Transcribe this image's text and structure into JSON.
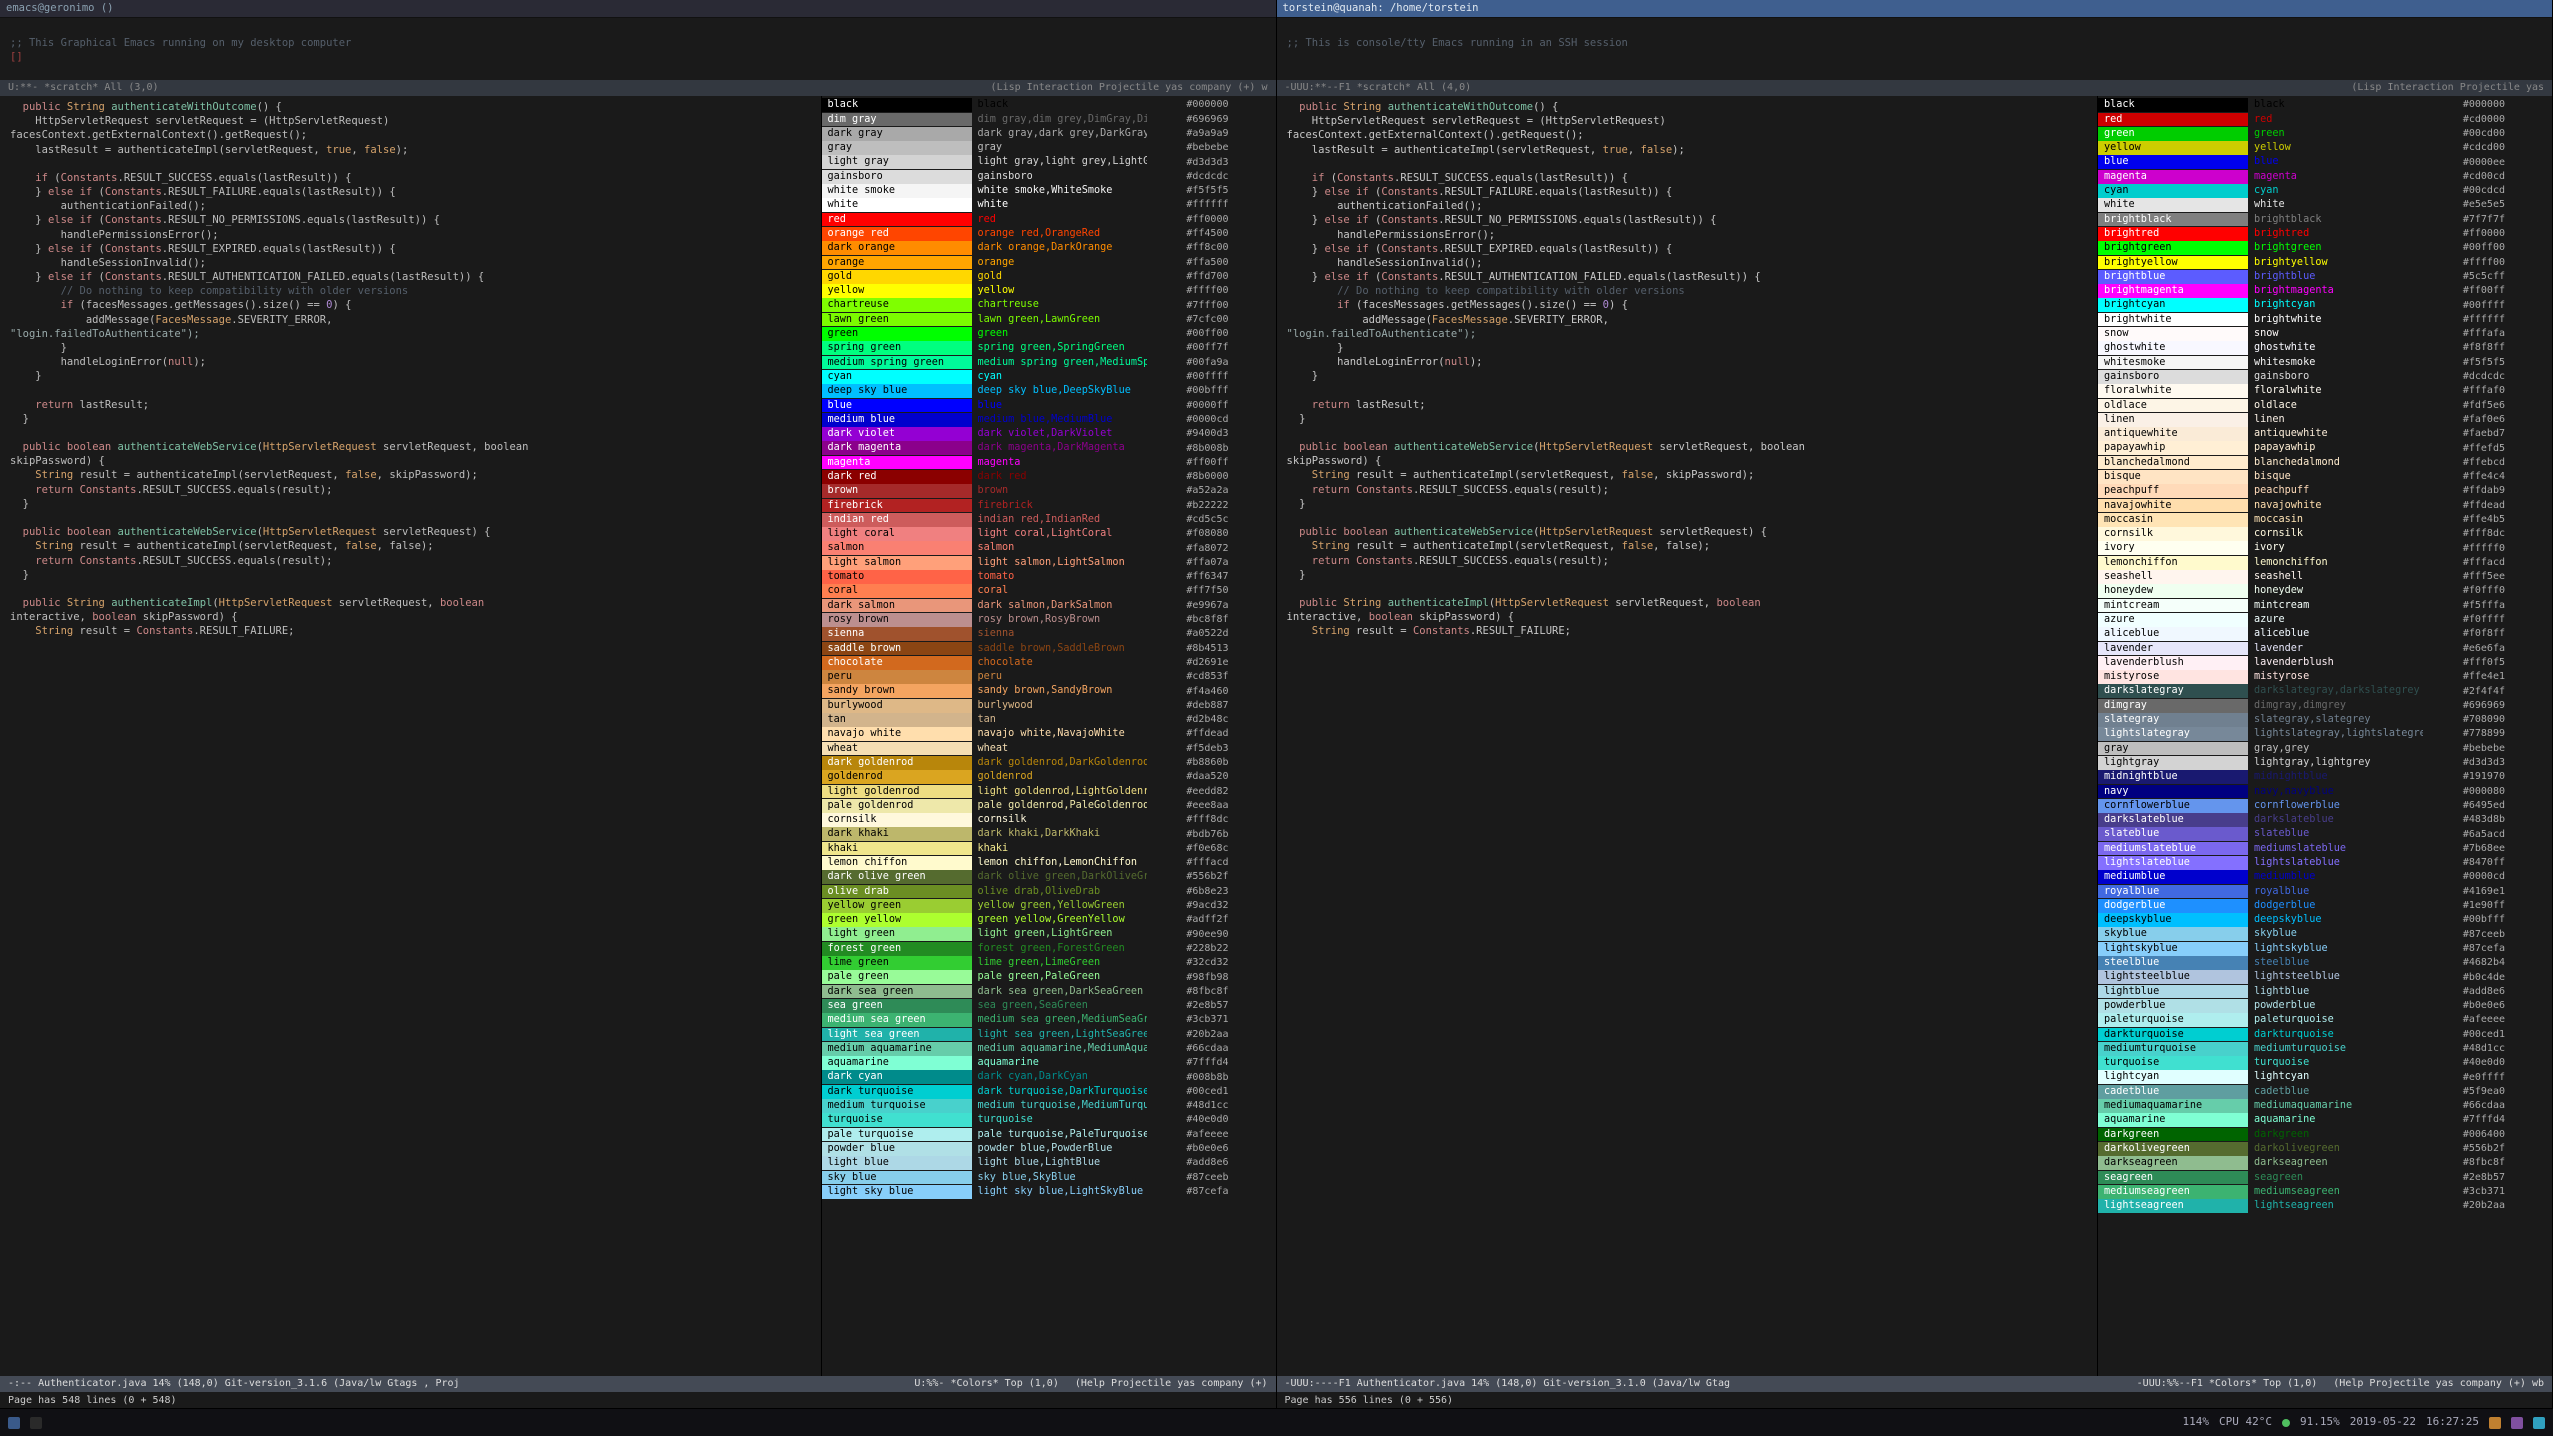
{
  "left": {
    "title": "emacs@geronimo ()",
    "scratch_comment": ";; This Graphical Emacs running on my desktop computer",
    "scratch_modeline": {
      "left": "U:**-  *scratch*   All (3,0)",
      "right": "(Lisp Interaction Projectile yas company (+) w"
    },
    "code_modeline": {
      "left": "-:--  Authenticator.java  14% (148,0)  Git-version_3.1.6  (Java/lw Gtags , Proj",
      "right": ""
    },
    "color_modeline": {
      "left": "U:%%-  *Colors*      Top (1,0)",
      "right": "(Help Projectile yas company (+)"
    },
    "minibuf": "Page has 548 lines (0 + 548)"
  },
  "right": {
    "title": "torstein@quanah: /home/torstein",
    "scratch_comment": ";; This is console/tty Emacs running in an SSH session",
    "scratch_modeline": {
      "left": "-UUU:**--F1  *scratch*      All (4,0)",
      "right": "(Lisp Interaction Projectile yas"
    },
    "code_modeline": {
      "left": "-UUU:----F1  Authenticator.java   14% (148,0)  Git-version_3.1.0  (Java/lw Gtag",
      "right": ""
    },
    "color_modeline": {
      "left": "-UUU:%%--F1  *Colors*      Top (1,0)",
      "right": "(Help Projectile yas company (+) wb"
    },
    "minibuf": "Page has 556 lines (0 + 556)"
  },
  "colors_left": [
    [
      "black",
      "#000000"
    ],
    [
      "dim gray",
      "#696969"
    ],
    [
      "dark gray",
      "#a9a9a9"
    ],
    [
      "gray",
      "#bebebe"
    ],
    [
      "light gray",
      "#d3d3d3"
    ],
    [
      "gainsboro",
      "#dcdcdc"
    ],
    [
      "white smoke",
      "#f5f5f5"
    ],
    [
      "white",
      "#ffffff"
    ],
    [
      "red",
      "#ff0000"
    ],
    [
      "orange red",
      "#ff4500"
    ],
    [
      "dark orange",
      "#ff8c00"
    ],
    [
      "orange",
      "#ffa500"
    ],
    [
      "gold",
      "#ffd700"
    ],
    [
      "yellow",
      "#ffff00"
    ],
    [
      "chartreuse",
      "#7fff00"
    ],
    [
      "lawn green",
      "#7cfc00"
    ],
    [
      "green",
      "#00ff00"
    ],
    [
      "spring green",
      "#00ff7f"
    ],
    [
      "medium spring green",
      "#00fa9a"
    ],
    [
      "cyan",
      "#00ffff"
    ],
    [
      "deep sky blue",
      "#00bfff"
    ],
    [
      "blue",
      "#0000ff"
    ],
    [
      "medium blue",
      "#0000cd"
    ],
    [
      "dark violet",
      "#9400d3"
    ],
    [
      "dark magenta",
      "#8b008b"
    ],
    [
      "magenta",
      "#ff00ff"
    ],
    [
      "dark red",
      "#8b0000"
    ],
    [
      "brown",
      "#a52a2a"
    ],
    [
      "firebrick",
      "#b22222"
    ],
    [
      "indian red",
      "#cd5c5c"
    ],
    [
      "light coral",
      "#f08080"
    ],
    [
      "salmon",
      "#fa8072"
    ],
    [
      "light salmon",
      "#ffa07a"
    ],
    [
      "tomato",
      "#ff6347"
    ],
    [
      "coral",
      "#ff7f50"
    ],
    [
      "dark salmon",
      "#e9967a"
    ],
    [
      "rosy brown",
      "#bc8f8f"
    ],
    [
      "sienna",
      "#a0522d"
    ],
    [
      "saddle brown",
      "#8b4513"
    ],
    [
      "chocolate",
      "#d2691e"
    ],
    [
      "peru",
      "#cd853f"
    ],
    [
      "sandy brown",
      "#f4a460"
    ],
    [
      "burlywood",
      "#deb887"
    ],
    [
      "tan",
      "#d2b48c"
    ],
    [
      "navajo white",
      "#ffdead"
    ],
    [
      "wheat",
      "#f5deb3"
    ],
    [
      "dark goldenrod",
      "#b8860b"
    ],
    [
      "goldenrod",
      "#daa520"
    ],
    [
      "light goldenrod",
      "#eedd82"
    ],
    [
      "pale goldenrod",
      "#eee8aa"
    ],
    [
      "cornsilk",
      "#fff8dc"
    ],
    [
      "dark khaki",
      "#bdb76b"
    ],
    [
      "khaki",
      "#f0e68c"
    ],
    [
      "lemon chiffon",
      "#fffacd"
    ],
    [
      "dark olive green",
      "#556b2f"
    ],
    [
      "olive drab",
      "#6b8e23"
    ],
    [
      "yellow green",
      "#9acd32"
    ],
    [
      "green yellow",
      "#adff2f"
    ],
    [
      "light green",
      "#90ee90"
    ],
    [
      "forest green",
      "#228b22"
    ],
    [
      "lime green",
      "#32cd32"
    ],
    [
      "pale green",
      "#98fb98"
    ],
    [
      "dark sea green",
      "#8fbc8f"
    ],
    [
      "sea green",
      "#2e8b57"
    ],
    [
      "medium sea green",
      "#3cb371"
    ],
    [
      "light sea green",
      "#20b2aa"
    ],
    [
      "medium aquamarine",
      "#66cdaa"
    ],
    [
      "aquamarine",
      "#7fffd4"
    ],
    [
      "dark cyan",
      "#008b8b"
    ],
    [
      "dark turquoise",
      "#00ced1"
    ],
    [
      "medium turquoise",
      "#48d1cc"
    ],
    [
      "turquoise",
      "#40e0d0"
    ],
    [
      "pale turquoise",
      "#afeeee"
    ],
    [
      "powder blue",
      "#b0e0e6"
    ],
    [
      "light blue",
      "#add8e6"
    ],
    [
      "sky blue",
      "#87ceeb"
    ],
    [
      "light sky blue",
      "#87cefa"
    ]
  ],
  "colors_right": [
    [
      "black",
      "#000000"
    ],
    [
      "red",
      "#cd0000"
    ],
    [
      "green",
      "#00cd00"
    ],
    [
      "yellow",
      "#cdcd00"
    ],
    [
      "blue",
      "#0000ee"
    ],
    [
      "magenta",
      "#cd00cd"
    ],
    [
      "cyan",
      "#00cdcd"
    ],
    [
      "white",
      "#e5e5e5"
    ],
    [
      "brightblack",
      "#7f7f7f"
    ],
    [
      "brightred",
      "#ff0000"
    ],
    [
      "brightgreen",
      "#00ff00"
    ],
    [
      "brightyellow",
      "#ffff00"
    ],
    [
      "brightblue",
      "#5c5cff"
    ],
    [
      "brightmagenta",
      "#ff00ff"
    ],
    [
      "brightcyan",
      "#00ffff"
    ],
    [
      "brightwhite",
      "#ffffff"
    ],
    [
      "snow",
      "#fffafa"
    ],
    [
      "ghostwhite",
      "#f8f8ff"
    ],
    [
      "whitesmoke",
      "#f5f5f5"
    ],
    [
      "gainsboro",
      "#dcdcdc"
    ],
    [
      "floralwhite",
      "#fffaf0"
    ],
    [
      "oldlace",
      "#fdf5e6"
    ],
    [
      "linen",
      "#faf0e6"
    ],
    [
      "antiquewhite",
      "#faebd7"
    ],
    [
      "papayawhip",
      "#ffefd5"
    ],
    [
      "blanchedalmond",
      "#ffebcd"
    ],
    [
      "bisque",
      "#ffe4c4"
    ],
    [
      "peachpuff",
      "#ffdab9"
    ],
    [
      "navajowhite",
      "#ffdead"
    ],
    [
      "moccasin",
      "#ffe4b5"
    ],
    [
      "cornsilk",
      "#fff8dc"
    ],
    [
      "ivory",
      "#fffff0"
    ],
    [
      "lemonchiffon",
      "#fffacd"
    ],
    [
      "seashell",
      "#fff5ee"
    ],
    [
      "honeydew",
      "#f0fff0"
    ],
    [
      "mintcream",
      "#f5fffa"
    ],
    [
      "azure",
      "#f0ffff"
    ],
    [
      "aliceblue",
      "#f0f8ff"
    ],
    [
      "lavender",
      "#e6e6fa"
    ],
    [
      "lavenderblush",
      "#fff0f5"
    ],
    [
      "mistyrose",
      "#ffe4e1"
    ],
    [
      "darkslategray",
      "#2f4f4f"
    ],
    [
      "dimgray",
      "#696969"
    ],
    [
      "slategray",
      "#708090"
    ],
    [
      "lightslategray",
      "#778899"
    ],
    [
      "gray",
      "#bebebe"
    ],
    [
      "lightgray",
      "#d3d3d3"
    ],
    [
      "midnightblue",
      "#191970"
    ],
    [
      "navy",
      "#000080"
    ],
    [
      "cornflowerblue",
      "#6495ed"
    ],
    [
      "darkslateblue",
      "#483d8b"
    ],
    [
      "slateblue",
      "#6a5acd"
    ],
    [
      "mediumslateblue",
      "#7b68ee"
    ],
    [
      "lightslateblue",
      "#8470ff"
    ],
    [
      "mediumblue",
      "#0000cd"
    ],
    [
      "royalblue",
      "#4169e1"
    ],
    [
      "dodgerblue",
      "#1e90ff"
    ],
    [
      "deepskyblue",
      "#00bfff"
    ],
    [
      "skyblue",
      "#87ceeb"
    ],
    [
      "lightskyblue",
      "#87cefa"
    ],
    [
      "steelblue",
      "#4682b4"
    ],
    [
      "lightsteelblue",
      "#b0c4de"
    ],
    [
      "lightblue",
      "#add8e6"
    ],
    [
      "powderblue",
      "#b0e0e6"
    ],
    [
      "paleturquoise",
      "#afeeee"
    ],
    [
      "darkturquoise",
      "#00ced1"
    ],
    [
      "mediumturquoise",
      "#48d1cc"
    ],
    [
      "turquoise",
      "#40e0d0"
    ],
    [
      "lightcyan",
      "#e0ffff"
    ],
    [
      "cadetblue",
      "#5f9ea0"
    ],
    [
      "mediumaquamarine",
      "#66cdaa"
    ],
    [
      "aquamarine",
      "#7fffd4"
    ],
    [
      "darkgreen",
      "#006400"
    ],
    [
      "darkolivegreen",
      "#556b2f"
    ],
    [
      "darkseagreen",
      "#8fbc8f"
    ],
    [
      "seagreen",
      "#2e8b57"
    ],
    [
      "mediumseagreen",
      "#3cb371"
    ],
    [
      "lightseagreen",
      "#20b2aa"
    ]
  ],
  "aliases_left": {
    "dim gray": "dim gray,dim grey,DimGray,DimGrey",
    "dark gray": "dark gray,dark grey,DarkGray,DarkGrey",
    "light gray": "light gray,light grey,LightGray,LightGrey",
    "white smoke": "white smoke,WhiteSmoke",
    "orange red": "orange red,OrangeRed",
    "dark orange": "dark orange,DarkOrange",
    "lawn green": "lawn green,LawnGreen",
    "spring green": "spring green,SpringGreen",
    "medium spring green": "medium spring green,MediumSpringGreen",
    "deep sky blue": "deep sky blue,DeepSkyBlue",
    "medium blue": "medium blue,MediumBlue",
    "dark violet": "dark violet,DarkViolet",
    "dark magenta": "dark magenta,DarkMagenta",
    "dark red": "dark red",
    "indian red": "indian red,IndianRed",
    "light coral": "light coral,LightCoral",
    "light salmon": "light salmon,LightSalmon",
    "dark salmon": "dark salmon,DarkSalmon",
    "rosy brown": "rosy brown,RosyBrown",
    "saddle brown": "saddle brown,SaddleBrown",
    "sandy brown": "sandy brown,SandyBrown",
    "navajo white": "navajo white,NavajoWhite",
    "dark goldenrod": "dark goldenrod,DarkGoldenrod",
    "light goldenrod": "light goldenrod,LightGoldenrod",
    "pale goldenrod": "pale goldenrod,PaleGoldenrod",
    "dark khaki": "dark khaki,DarkKhaki",
    "lemon chiffon": "lemon chiffon,LemonChiffon",
    "dark olive green": "dark olive green,DarkOliveGreen",
    "olive drab": "olive drab,OliveDrab",
    "yellow green": "yellow green,YellowGreen",
    "green yellow": "green yellow,GreenYellow",
    "light green": "light green,LightGreen",
    "forest green": "forest green,ForestGreen",
    "lime green": "lime green,LimeGreen",
    "pale green": "pale green,PaleGreen",
    "dark sea green": "dark sea green,DarkSeaGreen",
    "sea green": "sea green,SeaGreen",
    "medium sea green": "medium sea green,MediumSeaGreen",
    "light sea green": "light sea green,LightSeaGreen",
    "medium aquamarine": "medium aquamarine,MediumAquamarine",
    "dark cyan": "dark cyan,DarkCyan",
    "dark turquoise": "dark turquoise,DarkTurquoise",
    "medium turquoise": "medium turquoise,MediumTurquoise",
    "pale turquoise": "pale turquoise,PaleTurquoise",
    "powder blue": "powder blue,PowderBlue",
    "light blue": "light blue,LightBlue",
    "sky blue": "sky blue,SkyBlue",
    "light sky blue": "light sky blue,LightSkyBlue"
  },
  "aliases_right": {
    "darkslategray": "darkslategray,darkslategrey",
    "dimgray": "dimgray,dimgrey",
    "slategray": "slategray,slategrey",
    "lightslategray": "lightslategray,lightslategrey",
    "gray": "gray,grey",
    "lightgray": "lightgray,lightgrey",
    "navy": "navy,navyblue"
  },
  "code_lines": [
    {
      "t": "  public String authenticateWithOutcome() {",
      "c": [
        "kw:public",
        "type:String",
        "fn:authenticateWithOutcome"
      ]
    },
    {
      "t": "    HttpServletRequest servletRequest = (HttpServletRequest)"
    },
    {
      "t": "facesContext.getExternalContext().getRequest();"
    },
    {
      "t": "    lastResult = authenticateImpl(servletRequest, true, false);",
      "c": [
        "bool:true",
        "bool:false"
      ]
    },
    {
      "t": ""
    },
    {
      "t": "    if (Constants.RESULT_SUCCESS.equals(lastResult)) {",
      "c": [
        "kw:if",
        "const:Constants"
      ]
    },
    {
      "t": "    } else if (Constants.RESULT_FAILURE.equals(lastResult)) {",
      "c": [
        "kw:else",
        "kw:if",
        "const:Constants"
      ]
    },
    {
      "t": "        authenticationFailed();"
    },
    {
      "t": "    } else if (Constants.RESULT_NO_PERMISSIONS.equals(lastResult)) {",
      "c": [
        "kw:else",
        "kw:if",
        "const:Constants"
      ]
    },
    {
      "t": "        handlePermissionsError();"
    },
    {
      "t": "    } else if (Constants.RESULT_EXPIRED.equals(lastResult)) {",
      "c": [
        "kw:else",
        "kw:if",
        "const:Constants"
      ]
    },
    {
      "t": "        handleSessionInvalid();"
    },
    {
      "t": "    } else if (Constants.RESULT_AUTHENTICATION_FAILED.equals(lastResult)) {",
      "c": [
        "kw:else",
        "kw:if",
        "const:Constants"
      ]
    },
    {
      "t": "        // Do nothing to keep compatibility with older versions",
      "c": [
        "comment:*"
      ]
    },
    {
      "t": "        if (facesMessages.getMessages().size() == 0) {",
      "c": [
        "kw:if",
        "num:0"
      ]
    },
    {
      "t": "            addMessage(FacesMessage.SEVERITY_ERROR,",
      "c": [
        "type:FacesMessage"
      ]
    },
    {
      "t": "\"login.failedToAuthenticate\");",
      "c": [
        "str:*"
      ]
    },
    {
      "t": "        }"
    },
    {
      "t": "        handleLoginError(null);",
      "c": [
        "kw:null"
      ]
    },
    {
      "t": "    }"
    },
    {
      "t": ""
    },
    {
      "t": "    return lastResult;",
      "c": [
        "kw:return"
      ]
    },
    {
      "t": "  }"
    },
    {
      "t": ""
    },
    {
      "t": "  public boolean authenticateWebService(HttpServletRequest servletRequest, boolean",
      "c": [
        "kw:public",
        "kw:boolean",
        "fn:authenticateWebService",
        "type:HttpServletRequest",
        "kw:boolean"
      ]
    },
    {
      "t": "skipPassword) {"
    },
    {
      "t": "    String result = authenticateImpl(servletRequest, false, skipPassword);",
      "c": [
        "type:String",
        "bool:false"
      ]
    },
    {
      "t": "    return Constants.RESULT_SUCCESS.equals(result);",
      "c": [
        "kw:return",
        "const:Constants"
      ]
    },
    {
      "t": "  }"
    },
    {
      "t": ""
    },
    {
      "t": "  public boolean authenticateWebService(HttpServletRequest servletRequest) {",
      "c": [
        "kw:public",
        "kw:boolean",
        "fn:authenticateWebService",
        "type:HttpServletRequest"
      ]
    },
    {
      "t": "    String result = authenticateImpl(servletRequest, false, false);",
      "c": [
        "type:String",
        "bool:false",
        "bool:false"
      ]
    },
    {
      "t": "    return Constants.RESULT_SUCCESS.equals(result);",
      "c": [
        "kw:return",
        "const:Constants"
      ]
    },
    {
      "t": "  }"
    },
    {
      "t": ""
    },
    {
      "t": "  public String authenticateImpl(HttpServletRequest servletRequest, boolean",
      "c": [
        "kw:public",
        "type:String",
        "fn:authenticateImpl",
        "type:HttpServletRequest",
        "kw:boolean"
      ]
    },
    {
      "t": "interactive, boolean skipPassword) {",
      "c": [
        "kw:boolean"
      ]
    },
    {
      "t": "    String result = Constants.RESULT_FAILURE;",
      "c": [
        "type:String",
        "const:Constants"
      ]
    }
  ],
  "taskbar": {
    "zoom": "114%",
    "cpu": "CPU 42°C",
    "ram": "91.15%",
    "date": "2019-05-22",
    "time": "16:27:25"
  }
}
